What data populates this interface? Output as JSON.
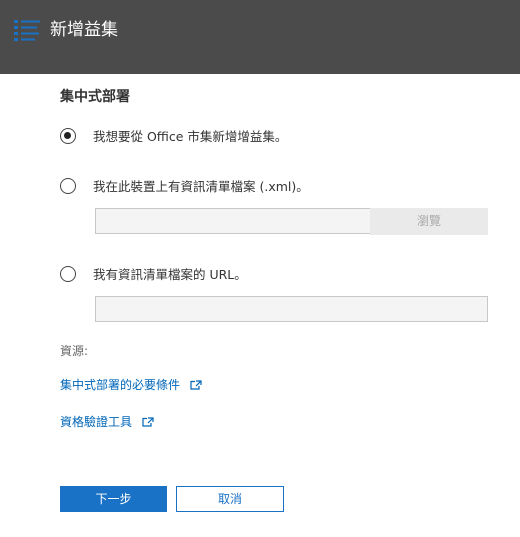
{
  "header": {
    "title": "新增益集",
    "icon": "list-icon",
    "background": "#4b4b4b"
  },
  "section": {
    "title": "集中式部署"
  },
  "options": [
    {
      "label": "我想要從 Office 市集新增增益集。",
      "checked": true
    },
    {
      "label": "我在此裝置上有資訊清單檔案 (.xml)。",
      "checked": false
    },
    {
      "label": "我有資訊清單檔案的 URL。",
      "checked": false
    }
  ],
  "file_input": {
    "value": ""
  },
  "browse_button": {
    "label": "瀏覽"
  },
  "url_input": {
    "value": ""
  },
  "resources": {
    "label": "資源:",
    "links": [
      {
        "label": "集中式部署的必要條件",
        "icon": "external-link-icon"
      },
      {
        "label": "資格驗證工具",
        "icon": "external-link-icon"
      }
    ]
  },
  "footer": {
    "next_label": "下一步",
    "cancel_label": "取消"
  },
  "colors": {
    "accent": "#1a72c6",
    "link": "#0066b8"
  }
}
